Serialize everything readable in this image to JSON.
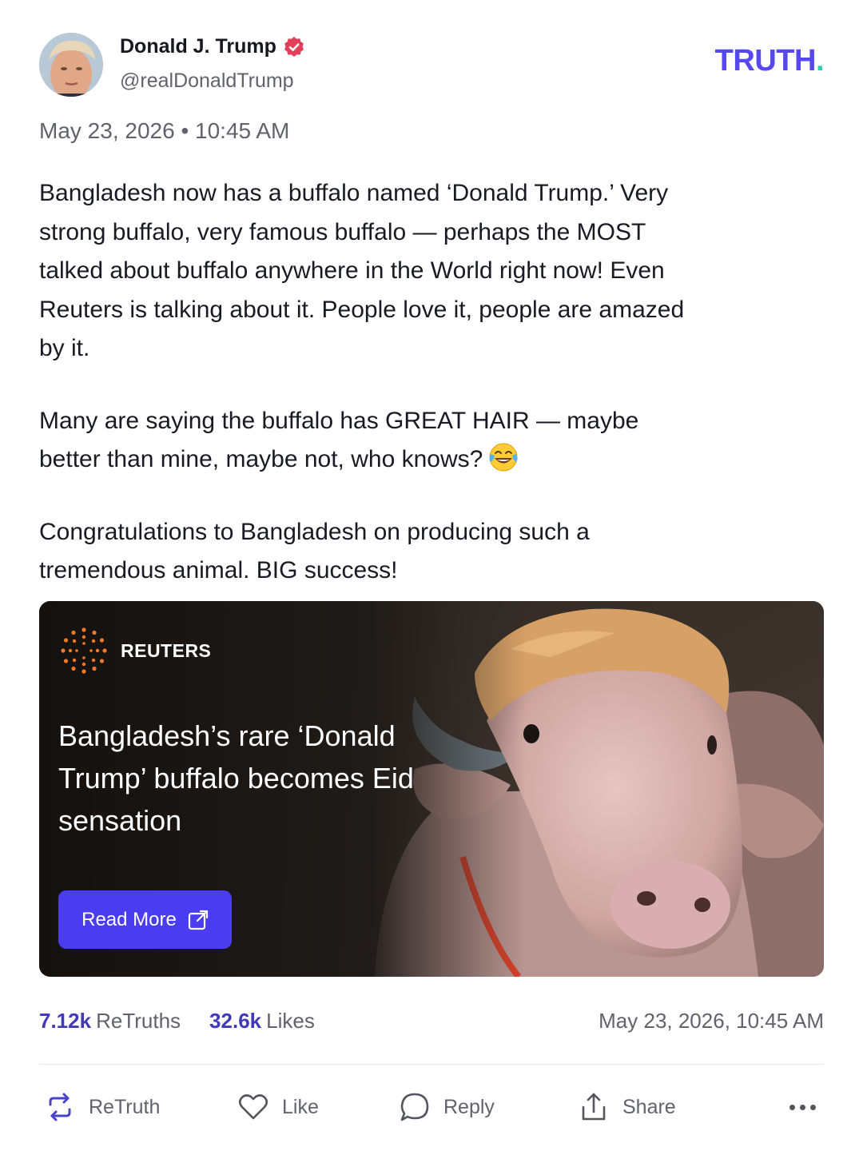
{
  "author": {
    "name": "Donald J. Trump",
    "handle": "@realDonaldTrump",
    "verified": true
  },
  "brand": {
    "text": "TRUTH",
    "dot": ".",
    "color": "#5448ee",
    "dot_color": "#2ad3b0"
  },
  "timestamp": "May 23, 2026 • 10:45 AM",
  "post": {
    "paragraph_1": "Bangladesh now has a buffalo named ‘Donald Trump.’ Very strong buffalo, very famous buffalo — perhaps the MOST talked about buffalo anywhere in the World right now! Even Reuters is talking about it. People love it, people are amazed by it.",
    "paragraph_2": "Many are saying the buffalo has GREAT HAIR — maybe better than mine, maybe not, who knows?",
    "paragraph_2_emoji": "face-with-tears-of-joy",
    "paragraph_3": "Congratulations to Bangladesh on producing such a tremendous animal. BIG success!"
  },
  "link_card": {
    "source": "REUTERS",
    "headline": "Bangladesh’s rare ‘Donald Trump’ buffalo becomes Eid sensation",
    "button_label": "Read More",
    "button_icon": "external-link-icon",
    "button_color": "#4a3df0"
  },
  "stats": {
    "retruths_count": "7.12k",
    "retruths_label": "ReTruths",
    "likes_count": "32.6k",
    "likes_label": "Likes",
    "date": "May 23, 2026, 10:45 AM"
  },
  "actions": {
    "retruth": "ReTruth",
    "like": "Like",
    "reply": "Reply",
    "share": "Share"
  }
}
